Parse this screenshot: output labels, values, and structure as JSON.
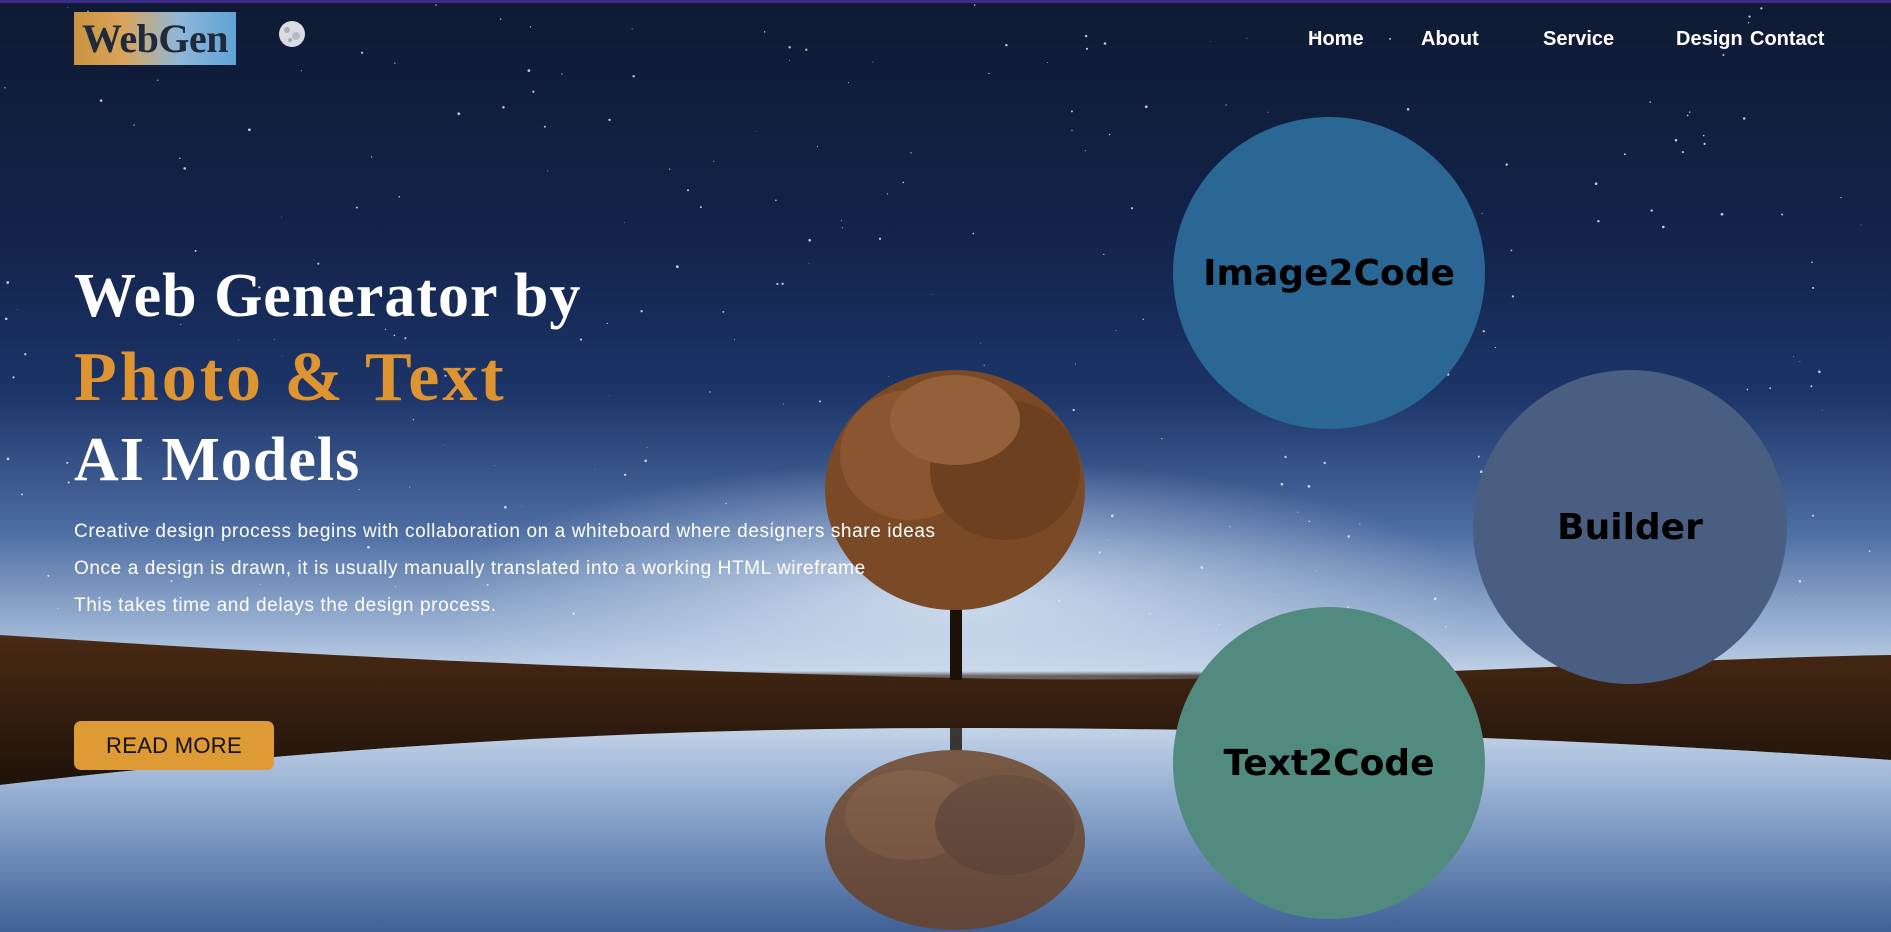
{
  "brand": {
    "logo_text": "WebGen",
    "moon_icon": "moon-icon"
  },
  "nav": {
    "items": [
      {
        "label": "Home"
      },
      {
        "label": "About"
      },
      {
        "label": "Service"
      },
      {
        "label": "Design"
      },
      {
        "label": "Contact"
      }
    ]
  },
  "hero": {
    "title_line1": "Web Generator by",
    "title_line2": "Photo & Text",
    "title_line3": "AI Models",
    "description": [
      "Creative design process begins with collaboration on a whiteboard where designers share ideas",
      "Once a design is drawn, it is usually manually translated into a working HTML wireframe",
      "This takes time and delays the design process."
    ],
    "cta_label": "READ MORE"
  },
  "features": [
    {
      "label": "Image2Code",
      "color": "#2a6794"
    },
    {
      "label": "Builder",
      "color": "#4a5e82"
    },
    {
      "label": "Text2Code",
      "color": "#518a7e"
    }
  ],
  "colors": {
    "accent": "#dd9431",
    "top_border": "#3e2a8a"
  }
}
